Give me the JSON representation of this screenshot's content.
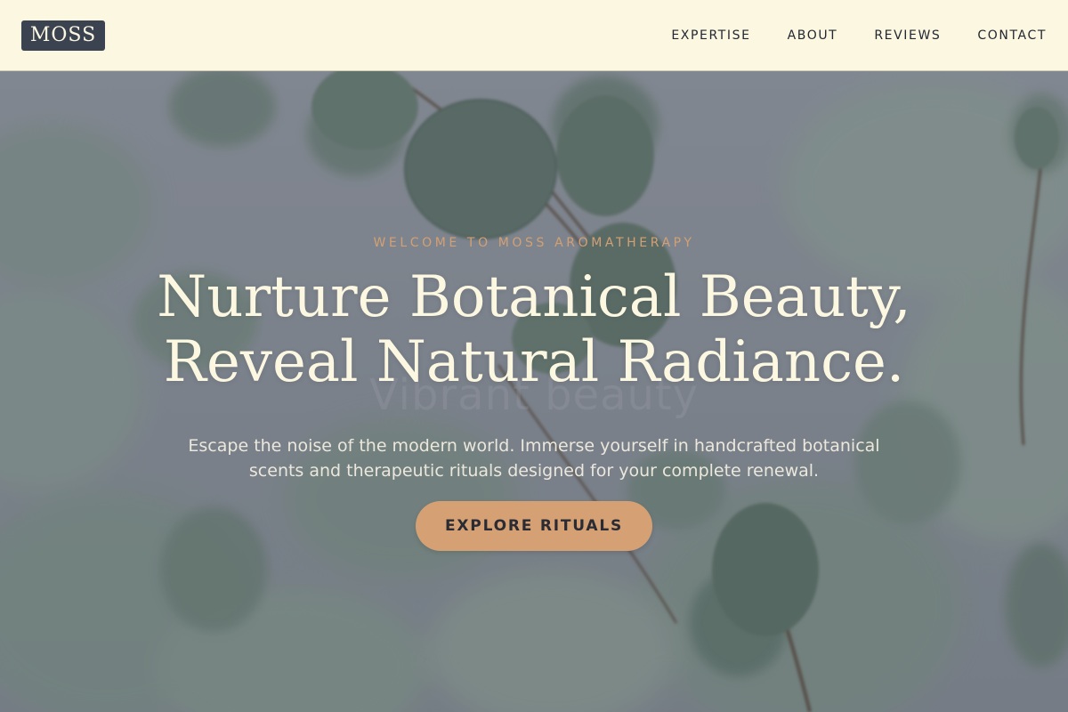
{
  "brand": {
    "logo_text": "MOSS"
  },
  "nav": {
    "items": [
      {
        "label": "EXPERTISE"
      },
      {
        "label": "ABOUT"
      },
      {
        "label": "REVIEWS"
      },
      {
        "label": "CONTACT"
      }
    ]
  },
  "hero": {
    "eyebrow": "WELCOME TO MOSS AROMATHERAPY",
    "headline_line1": "Nurture Botanical Beauty,",
    "headline_line2": "Reveal Natural Radiance.",
    "ghost_text": "Vibrant beauty",
    "subtext": "Escape the noise of the modern world. Immerse yourself in handcrafted botanical scents and therapeutic rituals designed for your complete renewal.",
    "cta_label": "EXPLORE RITUALS",
    "background_image": "eucalyptus-leaves-photo"
  },
  "colors": {
    "nav_background": "#fcf7e1",
    "logo_background": "#3c4350",
    "accent": "#d5a174",
    "headline_text": "#fcf7e1"
  }
}
